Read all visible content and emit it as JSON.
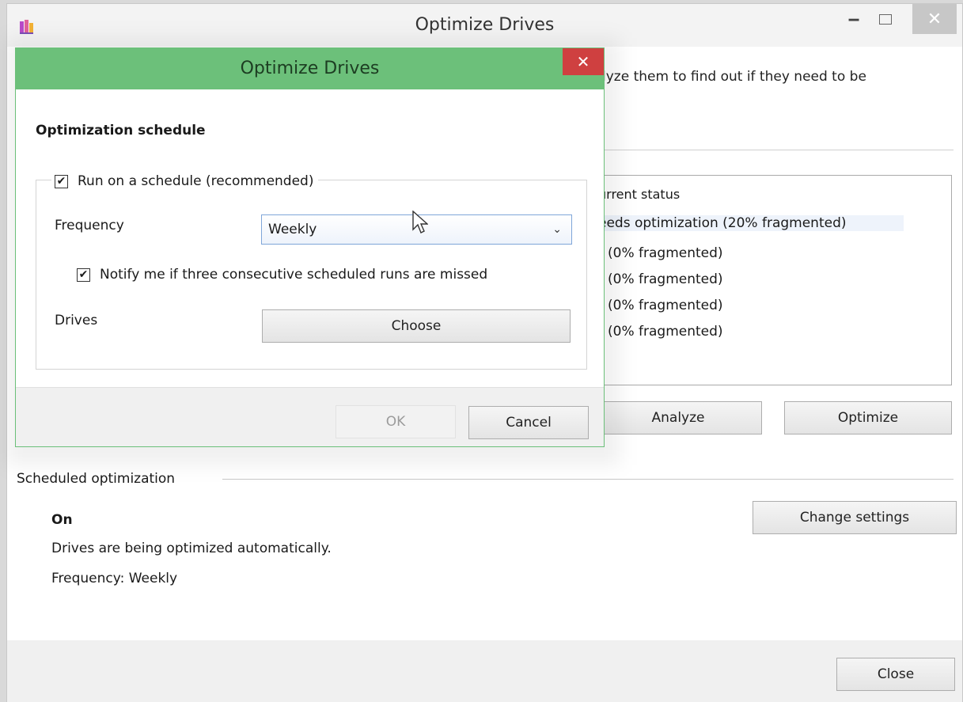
{
  "main_window": {
    "title": "Optimize Drives",
    "app_icon": "defrag-app-icon",
    "controls": {
      "minimize": "‒",
      "maximize": "☐",
      "close": "✕"
    },
    "intro_text": "lyze them to find out if they need to be",
    "status_panel": {
      "header": "urrent status",
      "rows": [
        "eeds optimization (20% fragmented)",
        "( (0% fragmented)",
        "( (0% fragmented)",
        "( (0% fragmented)",
        "( (0% fragmented)"
      ]
    },
    "buttons": {
      "analyze": "Analyze",
      "optimize": "Optimize"
    },
    "scheduled": {
      "section_label": "Scheduled optimization",
      "state": "On",
      "description": "Drives are being optimized automatically.",
      "frequency": "Frequency: Weekly",
      "change_button": "Change settings"
    },
    "close_button": "Close"
  },
  "dialog": {
    "title": "Optimize Drives",
    "close_glyph": "✕",
    "heading": "Optimization schedule",
    "run_on_schedule": {
      "label": "Run on a schedule (recommended)",
      "checked": true
    },
    "frequency_label": "Frequency",
    "frequency_value": "Weekly",
    "notify": {
      "label": "Notify me if three consecutive scheduled runs are missed",
      "checked": true
    },
    "drives_label": "Drives",
    "choose_button": "Choose",
    "ok_button": "OK",
    "cancel_button": "Cancel",
    "check_glyph": "✔",
    "dropdown_glyph": "⌄"
  }
}
